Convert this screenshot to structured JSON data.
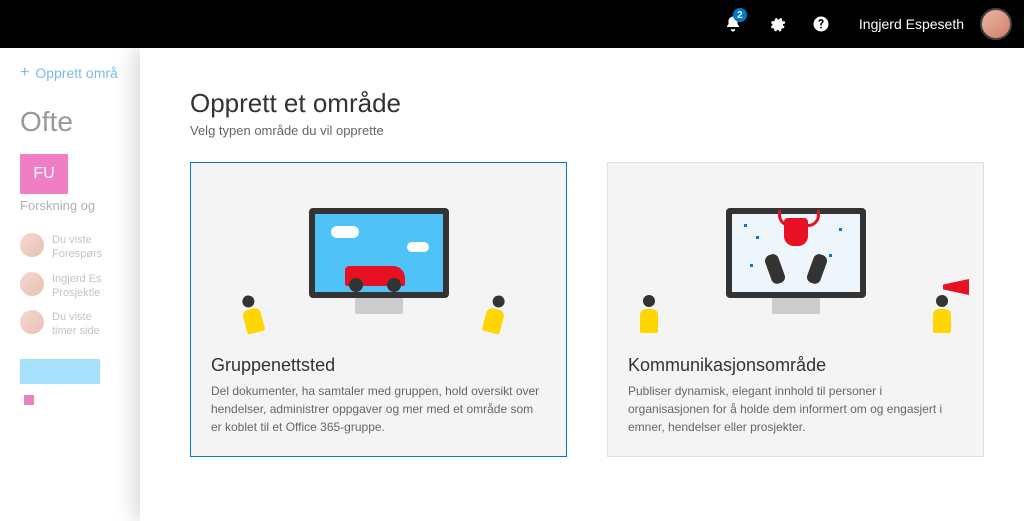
{
  "topbar": {
    "notification_count": "2",
    "user_name": "Ingjerd Espeseth"
  },
  "sidebar": {
    "create_label": "Opprett områ",
    "frequent_heading": "Ofte",
    "site_tile": "FU",
    "site_name": "Forskning og",
    "activities": [
      {
        "line1": "Du viste",
        "line2": "Forespørs"
      },
      {
        "line1": "Ingjerd Es",
        "line2": "Prosjektle"
      },
      {
        "line1": "Du viste",
        "line2": "timer side"
      }
    ]
  },
  "panel": {
    "title": "Opprett et område",
    "subtitle": "Velg typen område du vil opprette",
    "cards": [
      {
        "title": "Gruppenettsted",
        "description": "Del dokumenter, ha samtaler med gruppen, hold oversikt over hendelser, administrer oppgaver og mer med et område som er koblet til et Office 365-gruppe."
      },
      {
        "title": "Kommunikasjonsområde",
        "description": "Publiser dynamisk, elegant innhold til personer i organisasjonen for å holde dem informert om og engasjert i emner, hendelser eller prosjekter."
      }
    ]
  }
}
